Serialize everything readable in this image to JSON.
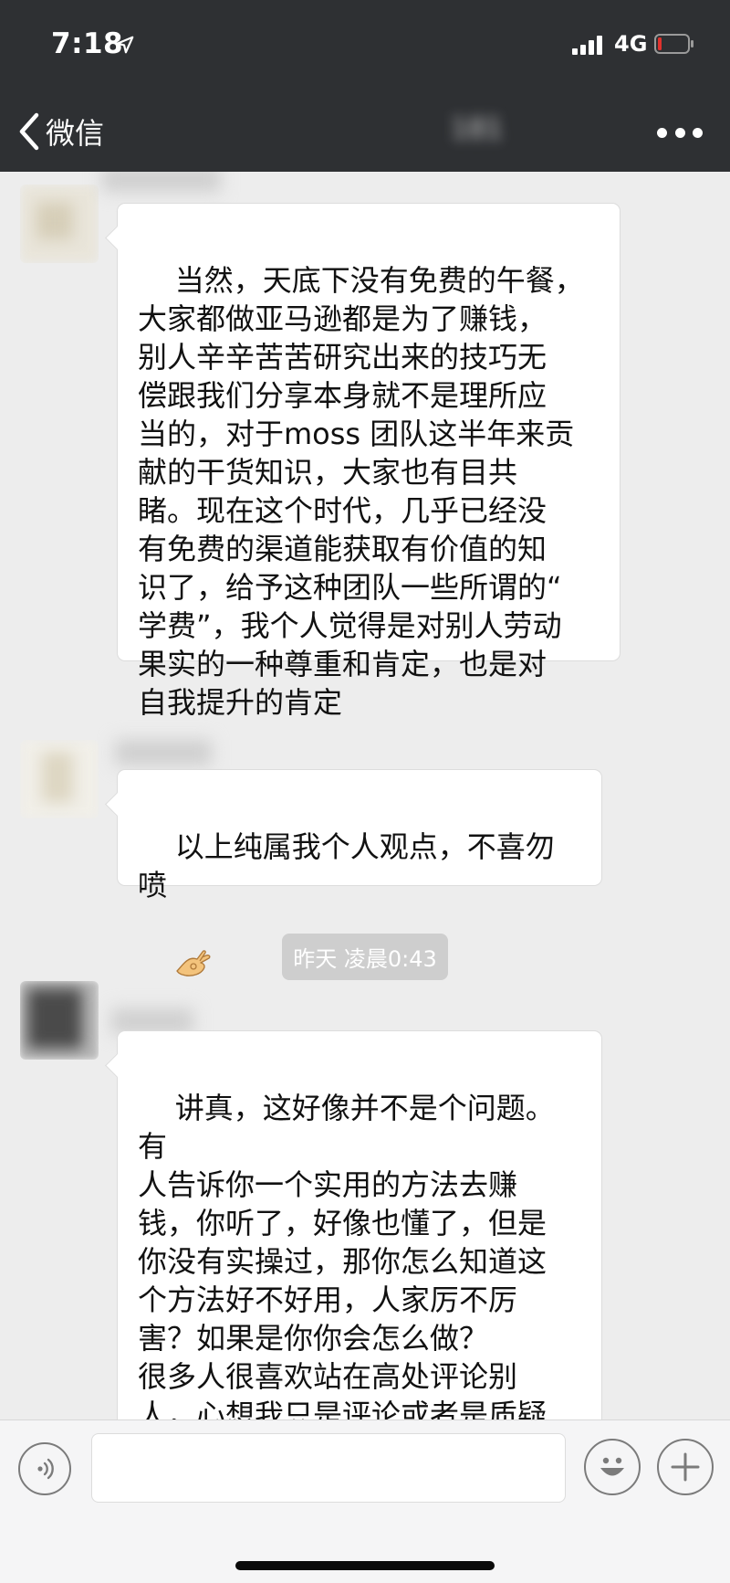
{
  "status_bar": {
    "time": "7:18",
    "network": "4G",
    "icons": [
      "location-arrow-icon",
      "signal-bars-icon",
      "battery-low-icon"
    ],
    "battery_color": "#e0322d"
  },
  "nav": {
    "back_label": "微信",
    "title": "181",
    "icons": [
      "chevron-left-icon",
      "more-dots-icon"
    ]
  },
  "messages": [
    {
      "text": "当然，天底下没有免费的午餐，\n大家都做亚马逊都是为了赚钱，\n别人辛辛苦苦研究出来的技巧无\n偿跟我们分享本身就不是理所应\n当的，对于moss 团队这半年来贡\n献的干货知识，大家也有目共\n睹。现在这个时代，几乎已经没\n有免费的渠道能获取有价值的知\n识了，给予这种团队一些所谓的“\n学费”，我个人觉得是对别人劳动\n果实的一种尊重和肯定，也是对\n自我提升的肯定"
    },
    {
      "text": "以上纯属我个人观点，不喜勿喷",
      "emoji": "ok-hand-icon"
    },
    {
      "text": "讲真，这好像并不是个问题。有\n人告诉你一个实用的方法去赚\n钱，你听了，好像也懂了，但是\n你没有实操过，那你怎么知道这\n个方法好不好用，人家厉不厉\n害？如果是你你会怎么做？\n很多人很喜欢站在高处评论别\n人，心想我只是评论或者是质疑\n并没有什么，但是其实这是对一\n个人自身修养和能力的放射，就"
    }
  ],
  "timestamp": "昨天 凌晨0:43",
  "input_bar": {
    "placeholder": "",
    "icons": [
      "voice-icon",
      "emoji-icon",
      "plus-icon"
    ]
  },
  "colors": {
    "header_bg": "#2e3033",
    "chat_bg": "#ededed",
    "bubble_bg": "#ffffff",
    "timestamp_bg": "#cecece"
  }
}
